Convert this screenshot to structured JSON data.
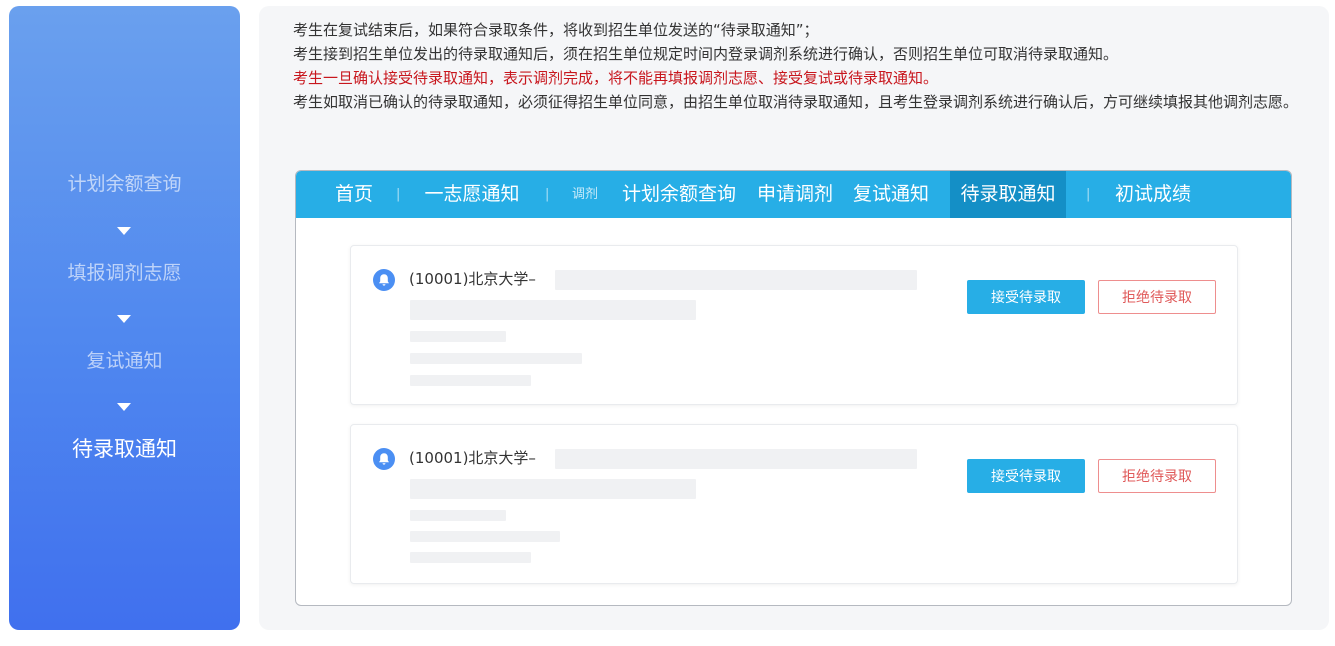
{
  "sidebar": {
    "steps": [
      "计划余额查询",
      "填报调剂志愿",
      "复试通知",
      "待录取通知"
    ],
    "active_step": "待录取通知"
  },
  "notice": {
    "line1": "考生在复试结束后，如果符合录取条件，将收到招生单位发送的“待录取通知”；",
    "line2": "考生接到招生单位发出的待录取通知后，须在招生单位规定时间内登录调剂系统进行确认，否则招生单位可取消待录取通知。",
    "line3": "考生一旦确认接受待录取通知，表示调剂完成，将不能再填报调剂志愿、接受复试或待录取通知。",
    "line4": "考生如取消已确认的待录取通知，必须征得招生单位同意，由招生单位取消待录取通知，且考生登录调剂系统进行确认后，方可继续填报其他调剂志愿。"
  },
  "nav": {
    "home": "首页",
    "first_choice": "一志愿通知",
    "adjust_small": "调剂",
    "plan_balance": "计划余额查询",
    "apply_adjust": "申请调剂",
    "retest": "复试通知",
    "pending": "待录取通知",
    "first_score": "初试成绩",
    "separator": "|"
  },
  "cards": [
    {
      "title": "(10001)北京大学–",
      "accept": "接受待录取",
      "reject": "拒绝待录取"
    },
    {
      "title": "(10001)北京大学–",
      "accept": "接受待录取",
      "reject": "拒绝待录取"
    }
  ],
  "colors": {
    "brand": "#27aee6",
    "warning": "#c8161d",
    "sidebar": "#4f87ef"
  },
  "icons": {
    "bell": "bell-icon",
    "step_arrow": "caret-down-icon"
  }
}
